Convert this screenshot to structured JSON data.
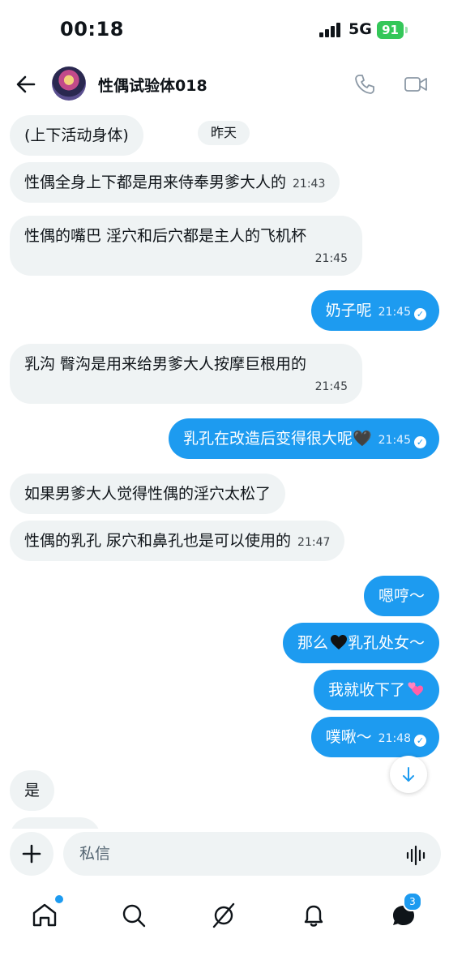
{
  "status_bar": {
    "time": "00:18",
    "network": "5G",
    "battery": "91"
  },
  "header": {
    "title": "性偶试验体018"
  },
  "date_chip": "昨天",
  "messages": [
    {
      "text": "(上下活动身体)"
    },
    {
      "text": "性偶全身上下都是用来侍奉男爹大人的",
      "time": "21:43"
    },
    {
      "text": "性偶的嘴巴 淫穴和后穴都是主人的飞机杯",
      "time": "21:45"
    },
    {
      "text": "奶子呢",
      "time": "21:45"
    },
    {
      "text": "乳沟 臀沟是用来给男爹大人按摩巨根用的",
      "time": "21:45"
    },
    {
      "text": "乳孔在改造后变得很大呢🖤",
      "time": "21:45"
    },
    {
      "text": "如果男爹大人觉得性偶的淫穴太松了"
    },
    {
      "text": "性偶的乳孔 尿穴和鼻孔也是可以使用的",
      "time": "21:47"
    },
    {
      "text": "嗯哼～"
    },
    {
      "text_before": "那么",
      "text_after": "乳孔处女～"
    },
    {
      "text": "我就收下了"
    },
    {
      "text": "噗啾～",
      "time": "21:48"
    },
    {
      "text": "是"
    }
  ],
  "composer": {
    "placeholder": "私信"
  },
  "nav": {
    "messages_badge": "3"
  },
  "colors": {
    "accent": "#1d9bf0",
    "incoming_bubble": "#eff3f4",
    "battery": "#34c759"
  },
  "icons": [
    "back-arrow-icon",
    "phone-icon",
    "video-icon",
    "chevron-down-icon",
    "plus-icon",
    "voice-wave-icon",
    "home-icon",
    "search-icon",
    "grok-icon",
    "bell-icon",
    "messages-icon",
    "black-heart-icon",
    "two-hearts-icon",
    "read-check-icon"
  ]
}
